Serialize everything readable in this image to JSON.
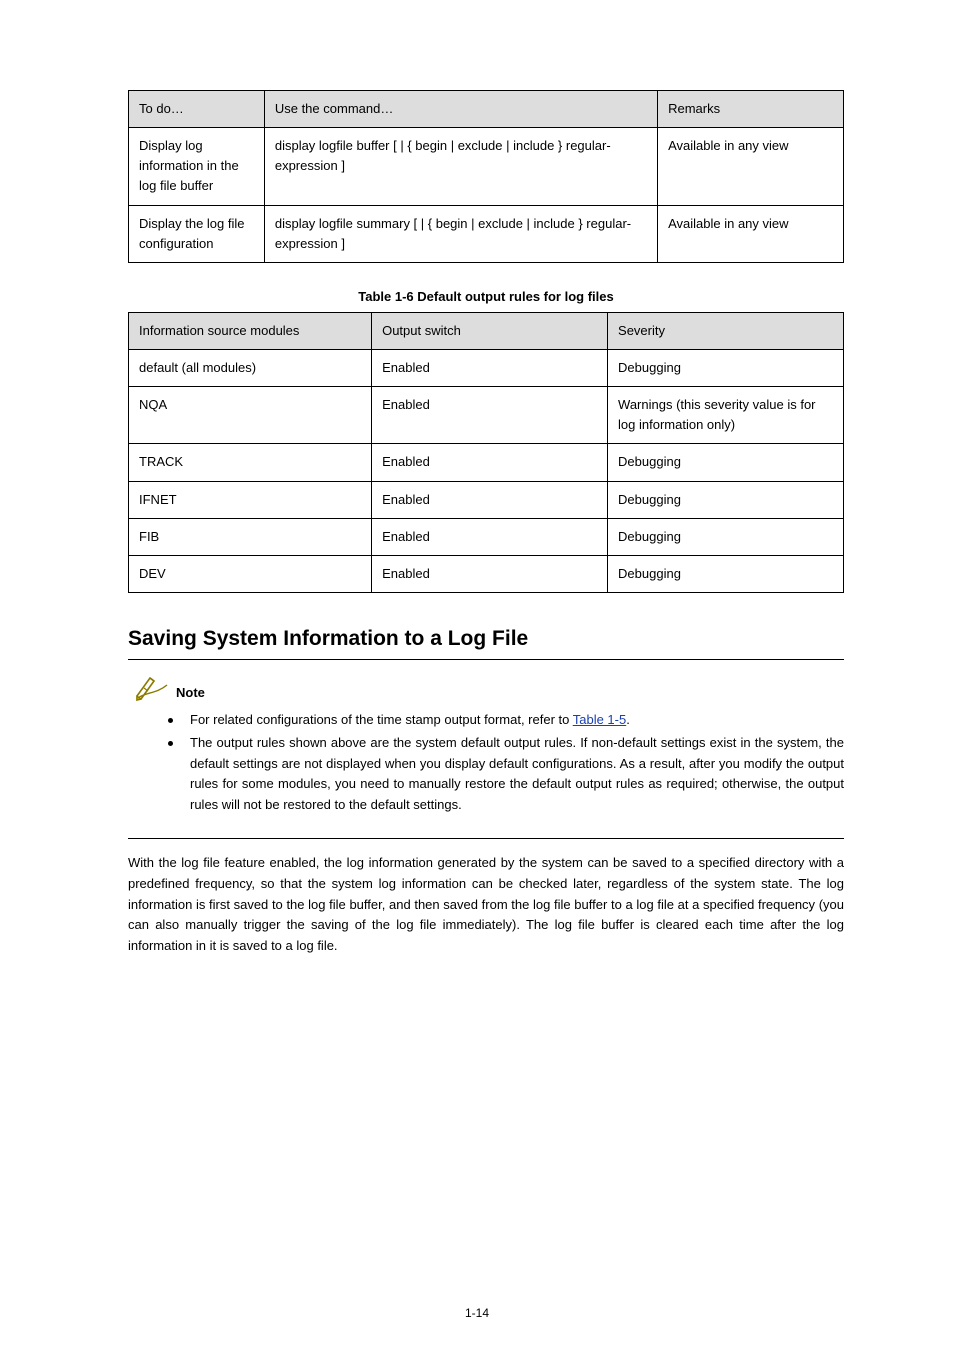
{
  "table1": {
    "headers": [
      "To do…",
      "Use the command…",
      "Remarks"
    ],
    "rows": [
      [
        "Display log information in the log file buffer",
        "display logfile buffer [ | { begin | exclude | include } regular-expression ]",
        "Available in any view"
      ],
      [
        "Display the log file configuration",
        "display logfile summary [ | { begin | exclude | include } regular-expression ]",
        "Available in any view"
      ]
    ]
  },
  "table2_caption": "Table 1-6 Default output rules for log files",
  "table2": {
    "headers": [
      "Information source modules",
      "Output switch",
      "Severity"
    ],
    "rows": [
      [
        "default (all modules)",
        "Enabled",
        "Debugging"
      ],
      [
        "NQA",
        "Enabled",
        "Warnings (this severity value is for log information only)"
      ],
      [
        "TRACK",
        "Enabled",
        "Debugging"
      ],
      [
        "IFNET",
        "Enabled",
        "Debugging"
      ],
      [
        "FIB",
        "Enabled",
        "Debugging"
      ],
      [
        "DEV",
        "Enabled",
        "Debugging"
      ]
    ]
  },
  "section_title": "Saving System Information to a Log File",
  "note": {
    "label": "Note",
    "items": [
      {
        "pre": "For related configurations of the time stamp output format, refer to ",
        "link": "Table 1-5",
        "post": "."
      },
      {
        "text": "The output rules shown above are the system default output rules. If non-default settings exist in the system, the default settings are not displayed when you display default configurations. As a result, after you modify the output rules for some modules, you need to manually restore the default output rules as required; otherwise, the output rules will not be restored to the default settings."
      }
    ]
  },
  "para": "With the log file feature enabled, the log information generated by the system can be saved to a specified directory with a predefined frequency, so that the system log information can be checked later, regardless of the system state. The log information is first saved to the log file buffer, and then saved from the log file buffer to a log file at a specified frequency (you can also manually trigger the saving of the log file immediately). The log file buffer is cleared each time after the log information in it is saved to a log file.",
  "page_number": "1-14"
}
